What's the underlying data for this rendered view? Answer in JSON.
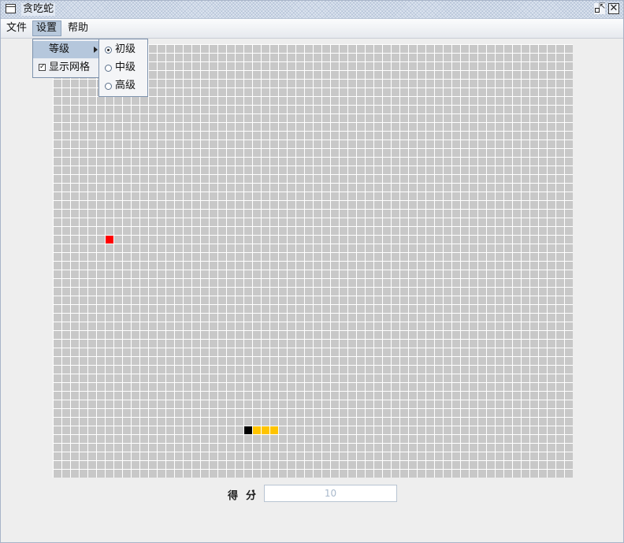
{
  "window": {
    "title": "贪吃蛇",
    "icon": "window-icon",
    "controls": [
      "restore-icon",
      "close-icon"
    ]
  },
  "menubar": {
    "items": [
      {
        "label": "文件"
      },
      {
        "label": "设置"
      },
      {
        "label": "帮助"
      }
    ]
  },
  "settings_menu": {
    "level_label": "等级",
    "show_grid_label": "显示网格",
    "show_grid_checked": true
  },
  "level_submenu": {
    "options": [
      {
        "label": "初级",
        "selected": true
      },
      {
        "label": "中级",
        "selected": false
      },
      {
        "label": "高级",
        "selected": false
      }
    ]
  },
  "game": {
    "grid_columns": 60,
    "grid_rows": 50,
    "food": {
      "col": 6,
      "row": 22
    },
    "snake": [
      {
        "col": 22,
        "row": 44,
        "part": "head"
      },
      {
        "col": 23,
        "row": 44,
        "part": "body"
      },
      {
        "col": 24,
        "row": 44,
        "part": "body"
      },
      {
        "col": 25,
        "row": 44,
        "part": "body"
      }
    ],
    "colors": {
      "food": "#ff0000",
      "head": "#000000",
      "body": "#ffc400",
      "empty_cell": "#c8c8c8",
      "grid_line": "#ffffff"
    }
  },
  "score": {
    "label": "得分",
    "colon": ":",
    "value": "10"
  }
}
